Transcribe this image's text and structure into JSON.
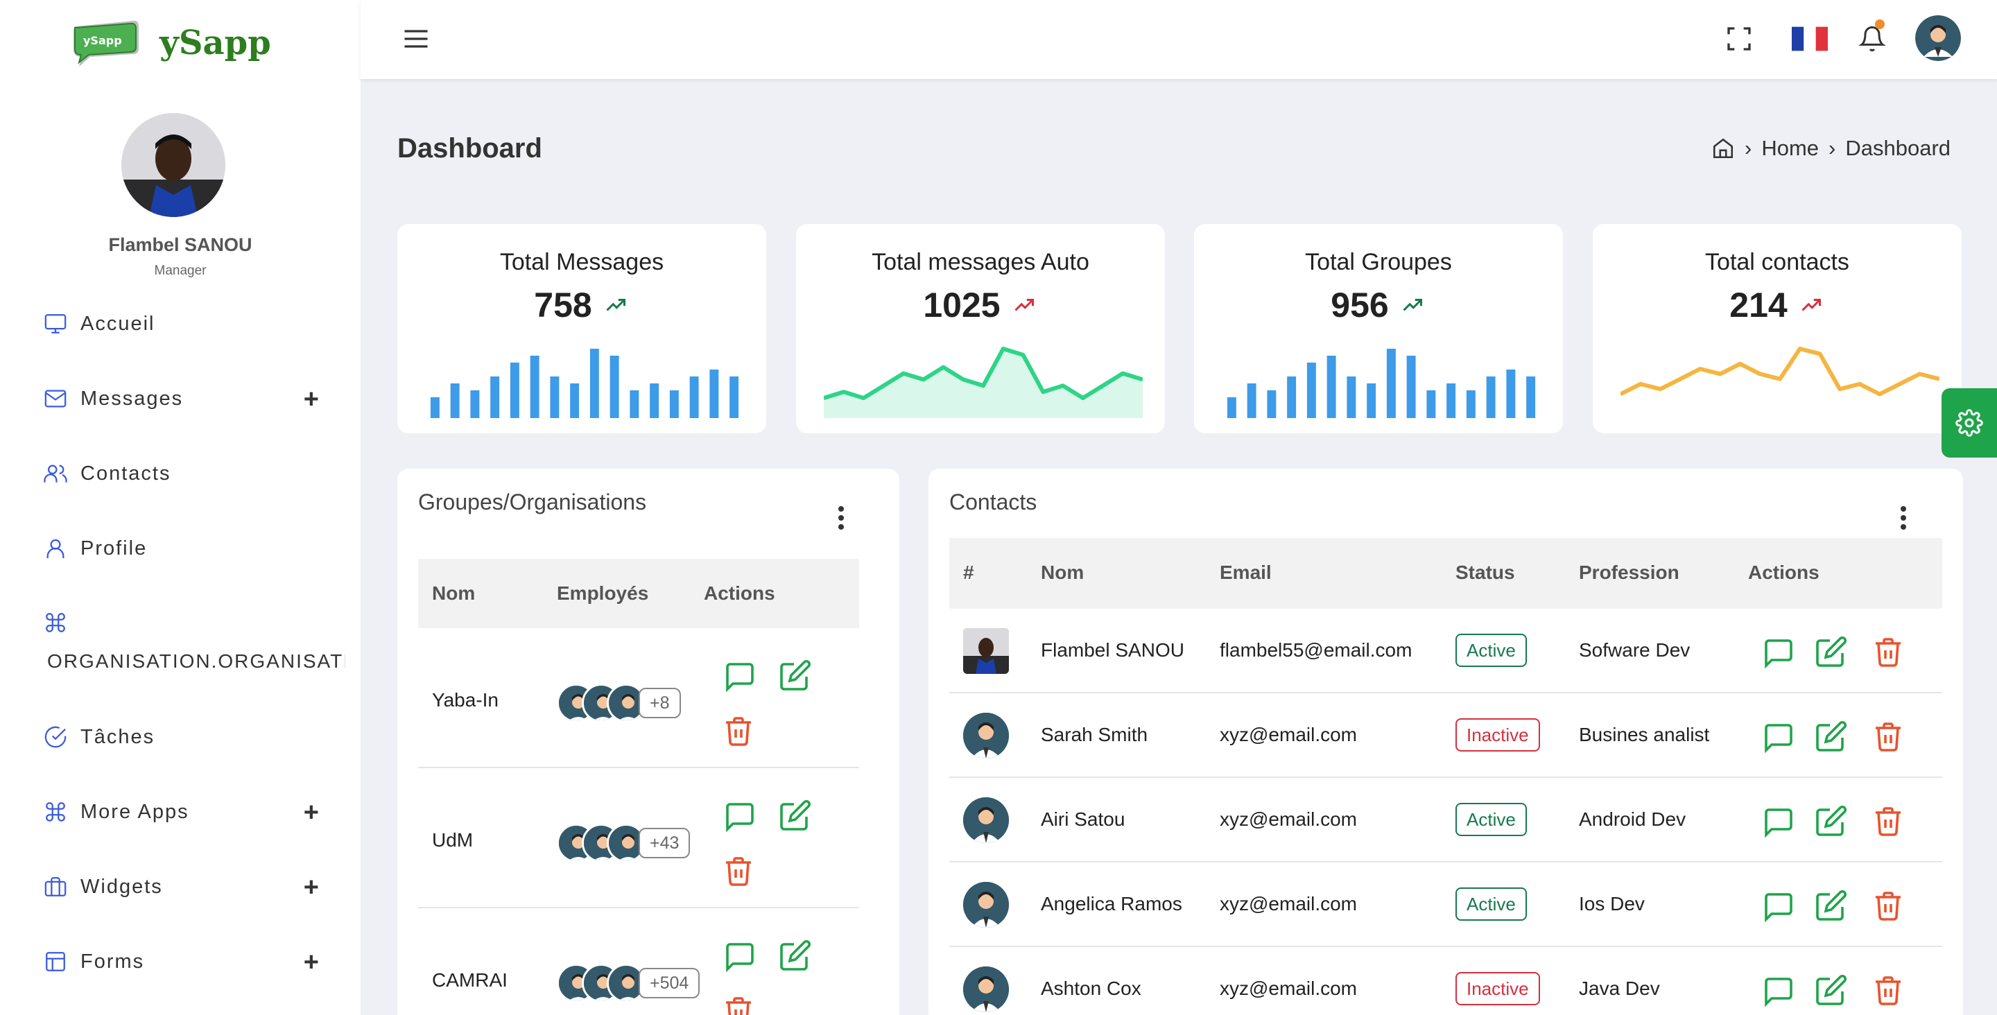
{
  "brand": {
    "name": "ySapp",
    "logo_text": "ySapp"
  },
  "user": {
    "name": "Flambel SANOU",
    "role": "Manager"
  },
  "sidebar": {
    "items": [
      {
        "label": "Accueil",
        "icon": "monitor-icon",
        "expandable": false
      },
      {
        "label": "Messages",
        "icon": "mail-icon",
        "expandable": true
      },
      {
        "label": "Contacts",
        "icon": "users-icon",
        "expandable": false
      },
      {
        "label": "Profile",
        "icon": "user-icon",
        "expandable": false
      },
      {
        "label": "ORGANISATION.ORGANISATIO",
        "icon": "command-icon",
        "expandable": false
      },
      {
        "label": "Tâches",
        "icon": "check-circle-icon",
        "expandable": false
      },
      {
        "label": "More Apps",
        "icon": "command-icon",
        "expandable": true
      },
      {
        "label": "Widgets",
        "icon": "briefcase-icon",
        "expandable": true
      },
      {
        "label": "Forms",
        "icon": "layout-icon",
        "expandable": true
      }
    ],
    "plus": "+"
  },
  "header": {
    "language_flag": "france-flag-icon",
    "notification_dot_color": "#f08c2a"
  },
  "page": {
    "title": "Dashboard",
    "breadcrumb": [
      "Home",
      "Dashboard"
    ]
  },
  "stats": [
    {
      "title": "Total Messages",
      "value": "758",
      "trend": "up",
      "trend_color": "#157a4f",
      "chart": "bar",
      "color": "#3d9be9",
      "series": [
        3,
        5,
        4,
        6,
        8,
        9,
        6,
        5,
        10,
        9,
        4,
        5,
        4,
        6,
        7,
        6
      ]
    },
    {
      "title": "Total messages Auto",
      "value": "1025",
      "trend": "up",
      "trend_color": "#d62f3e",
      "chart": "area",
      "color": "#2ed488",
      "series": [
        1,
        2,
        1,
        3,
        5,
        4,
        6,
        4,
        3,
        9,
        8,
        2,
        3,
        1,
        3,
        5,
        4
      ]
    },
    {
      "title": "Total Groupes",
      "value": "956",
      "trend": "up",
      "trend_color": "#157a4f",
      "chart": "bar",
      "color": "#3d9be9",
      "series": [
        3,
        5,
        4,
        6,
        8,
        9,
        6,
        5,
        10,
        9,
        4,
        5,
        4,
        6,
        7,
        6
      ]
    },
    {
      "title": "Total contacts",
      "value": "214",
      "trend": "up",
      "trend_color": "#d62f3e",
      "chart": "line",
      "color": "#f5b541",
      "series": [
        2,
        4,
        3,
        5,
        7,
        6,
        8,
        6,
        5,
        11,
        10,
        3,
        4,
        2,
        4,
        6,
        5
      ]
    }
  ],
  "groups": {
    "title": "Groupes/Organisations",
    "columns": [
      "Nom",
      "Employés",
      "Actions"
    ],
    "rows": [
      {
        "name": "Yaba-In",
        "more": "+8"
      },
      {
        "name": "UdM",
        "more": "+43"
      },
      {
        "name": "CAMRAI",
        "more": "+504"
      }
    ]
  },
  "contacts": {
    "title": "Contacts",
    "columns": [
      "#",
      "Nom",
      "Email",
      "Status",
      "Profession",
      "Actions"
    ],
    "rows": [
      {
        "name": "Flambel SANOU",
        "email": "flambel55@email.com",
        "status": "Active",
        "profession": "Sofware Dev"
      },
      {
        "name": "Sarah Smith",
        "email": "xyz@email.com",
        "status": "Inactive",
        "profession": "Busines analist"
      },
      {
        "name": "Airi Satou",
        "email": "xyz@email.com",
        "status": "Active",
        "profession": "Android Dev"
      },
      {
        "name": "Angelica Ramos",
        "email": "xyz@email.com",
        "status": "Active",
        "profession": "Ios Dev"
      },
      {
        "name": "Ashton Cox",
        "email": "xyz@email.com",
        "status": "Inactive",
        "profession": "Java Dev"
      }
    ]
  },
  "colors": {
    "message": "#1ea44a",
    "edit": "#1ea44a",
    "delete": "#e8532e",
    "active": "#157a4f",
    "inactive": "#d62f3e",
    "settings_tab": "#1ea44a"
  }
}
